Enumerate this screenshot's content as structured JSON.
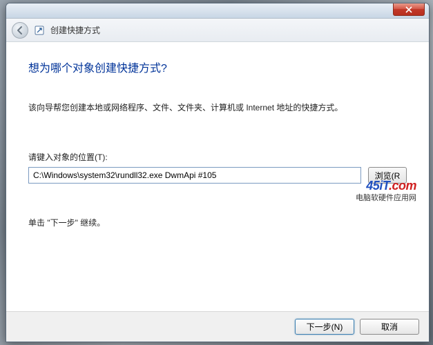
{
  "window": {
    "title": "创建快捷方式"
  },
  "content": {
    "heading": "想为哪个对象创建快捷方式?",
    "description": "该向导帮您创建本地或网络程序、文件、文件夹、计算机或 Internet 地址的快捷方式。",
    "field_label": "请键入对象的位置(T):",
    "path_value": "C:\\Windows\\system32\\rundll32.exe DwmApi #105",
    "browse_label": "浏览(R",
    "continue_text": "单击 \"下一步\" 继续。"
  },
  "footer": {
    "next_label": "下一步(N)",
    "cancel_label": "取消"
  },
  "watermark": {
    "logo_part1": "45iT",
    "logo_part2": ".com",
    "subtitle": "电脑软硬件应用网"
  }
}
